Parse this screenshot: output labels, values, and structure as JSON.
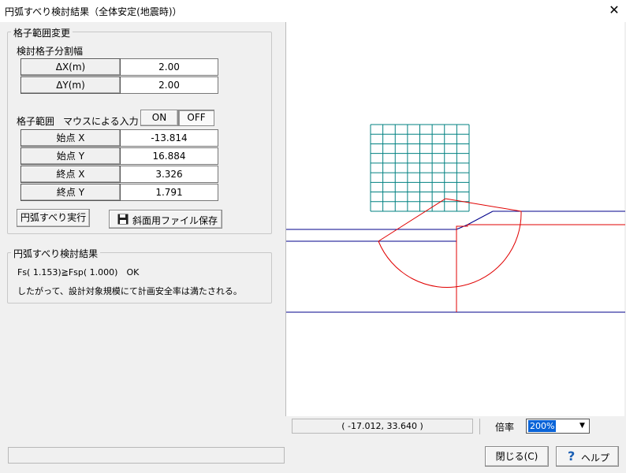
{
  "window": {
    "title": "円弧すべり検討結果（全体安定(地震時)）",
    "close_glyph": "✕"
  },
  "grid_range_change": {
    "group_label": "格子範囲変更",
    "division_label": "検討格子分割幅",
    "dx_label": "ΔX(m)",
    "dx_value": "2.00",
    "dy_label": "ΔY(m)",
    "dy_value": "2.00",
    "range_label": "格子範囲",
    "mouse_input_label": "マウスによる入力",
    "on_label": "ON",
    "off_label": "OFF",
    "mouse_input_state": "OFF",
    "start_x_label": "始点 X",
    "start_x_value": "-13.814",
    "start_y_label": "始点 Y",
    "start_y_value": "16.884",
    "end_x_label": "終点 X",
    "end_x_value": "3.326",
    "end_y_label": "終点 Y",
    "end_y_value": "1.791",
    "run_button": "円弧すべり実行",
    "save_button": "斜面用ファイル保存"
  },
  "result": {
    "group_label": "円弧すべり検討結果",
    "fs_line": "Fs( 1.153)≧Fsp( 1.000)　OK",
    "conclusion": "したがって、設計対象規模にて計画安全率は満たされる。"
  },
  "canvas": {
    "coordinate_readout": "(  -17.012,   33.640 )",
    "zoom_label": "倍率",
    "zoom_value": "200%",
    "colors": {
      "grid": "#008080",
      "ground_lines": "#00008b",
      "slip_circle": "#e00000"
    }
  },
  "footer": {
    "close_button": "閉じる(C)",
    "help_button": "ヘルプ",
    "help_icon": "question-icon"
  }
}
